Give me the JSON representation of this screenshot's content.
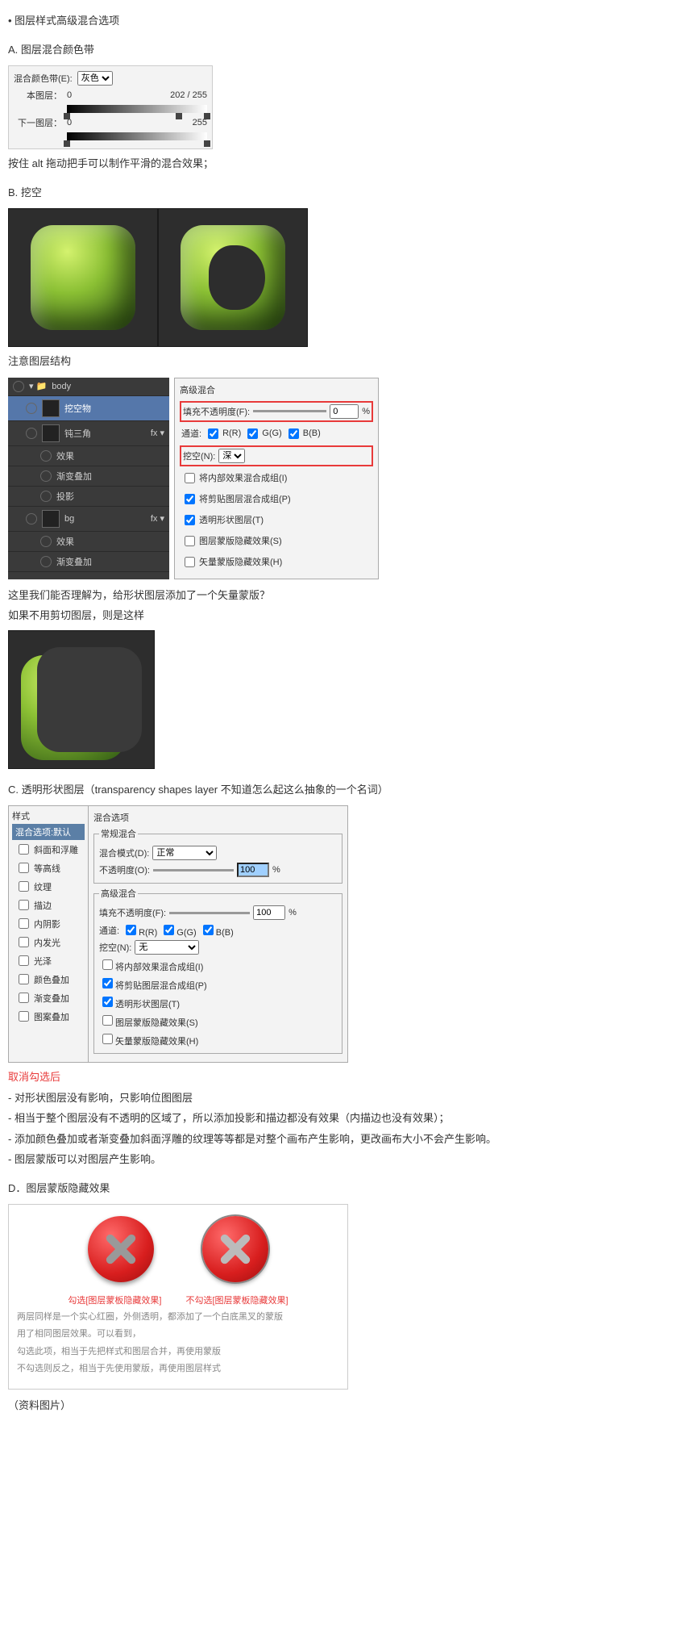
{
  "title_bullet": "• 图层样式高级混合选项",
  "a": {
    "heading": "A. 图层混合颜色带",
    "blend_band_label": "混合颜色带(E):",
    "blend_band_value": "灰色",
    "this_layer": "本图层：",
    "this_low": "0",
    "this_high": "202 / 255",
    "next_layer": "下一图层：",
    "next_low": "0",
    "next_high": "255",
    "caption": "按住 alt 拖动把手可以制作平滑的混合效果；"
  },
  "b": {
    "heading": "B. 挖空",
    "caption": "注意图层结构"
  },
  "layers": {
    "folder": "body",
    "l1": "挖空物",
    "l2": "钝三角",
    "fx": "效果",
    "grad": "渐变叠加",
    "shadow": "投影",
    "bg": "bg"
  },
  "adv": {
    "title": "高级混合",
    "fill_label": "填充不透明度(F):",
    "fill_val": "0",
    "pct": "%",
    "channels": "通道:",
    "r": "R(R)",
    "g": "G(G)",
    "b": "B(B)",
    "knockout_label": "挖空(N):",
    "knockout_val": "深",
    "c1": "将内部效果混合成组(I)",
    "c2": "将剪贴图层混合成组(P)",
    "c3": "透明形状图层(T)",
    "c4": "图层蒙版隐藏效果(S)",
    "c5": "矢量蒙版隐藏效果(H)"
  },
  "b_q": {
    "q1": "这里我们能否理解为，给形状图层添加了一个矢量蒙版？",
    "q2": "如果不用剪切图层，则是这样"
  },
  "c": {
    "heading": "C. 透明形状图层（transparency shapes layer 不知道怎么起这么抽象的一个名词）",
    "styles_hdr": "样式",
    "styles_sel": "混合选项:默认",
    "s1": "斜面和浮雕",
    "s2": "等高线",
    "s3": "纹理",
    "s4": "描边",
    "s5": "内阴影",
    "s6": "内发光",
    "s7": "光泽",
    "s8": "颜色叠加",
    "s9": "渐变叠加",
    "s10": "图案叠加",
    "blend_opts": "混合选项",
    "normal_blend": "常规混合",
    "mode_label": "混合模式(D):",
    "mode_val": "正常",
    "opacity_label": "不透明度(O):",
    "opacity_val": "100",
    "adv_title": "高级混合",
    "fill_val": "100",
    "knockout_val": "无"
  },
  "after_uncheck": {
    "hdr": "取消勾选后",
    "l1": "- 对形状图层没有影响，只影响位图图层",
    "l2": "- 相当于整个图层没有不透明的区域了，所以添加投影和描边都没有效果（内描边也没有效果）；",
    "l3": "- 添加颜色叠加或者渐变叠加斜面浮雕的纹理等等都是对整个画布产生影响，更改画布大小不会产生影响。",
    "l4": "- 图层蒙版可以对图层产生影响。"
  },
  "d": {
    "heading": "D．图层蒙版隐藏效果",
    "label_on": "勾选[图层蒙板隐藏效果]",
    "label_off": "不勾选[图层蒙板隐藏效果]",
    "note1": "两层同样是一个实心红圈，外侧透明，都添加了一个白底黑叉的蒙版",
    "note2": "用了相同图层效果。可以看到，",
    "note3": "勾选此项，相当于先把样式和图层合并，再使用蒙版",
    "note4": "不勾选则反之，相当于先使用蒙版，再使用图层样式"
  },
  "footer": "（资料图片）"
}
